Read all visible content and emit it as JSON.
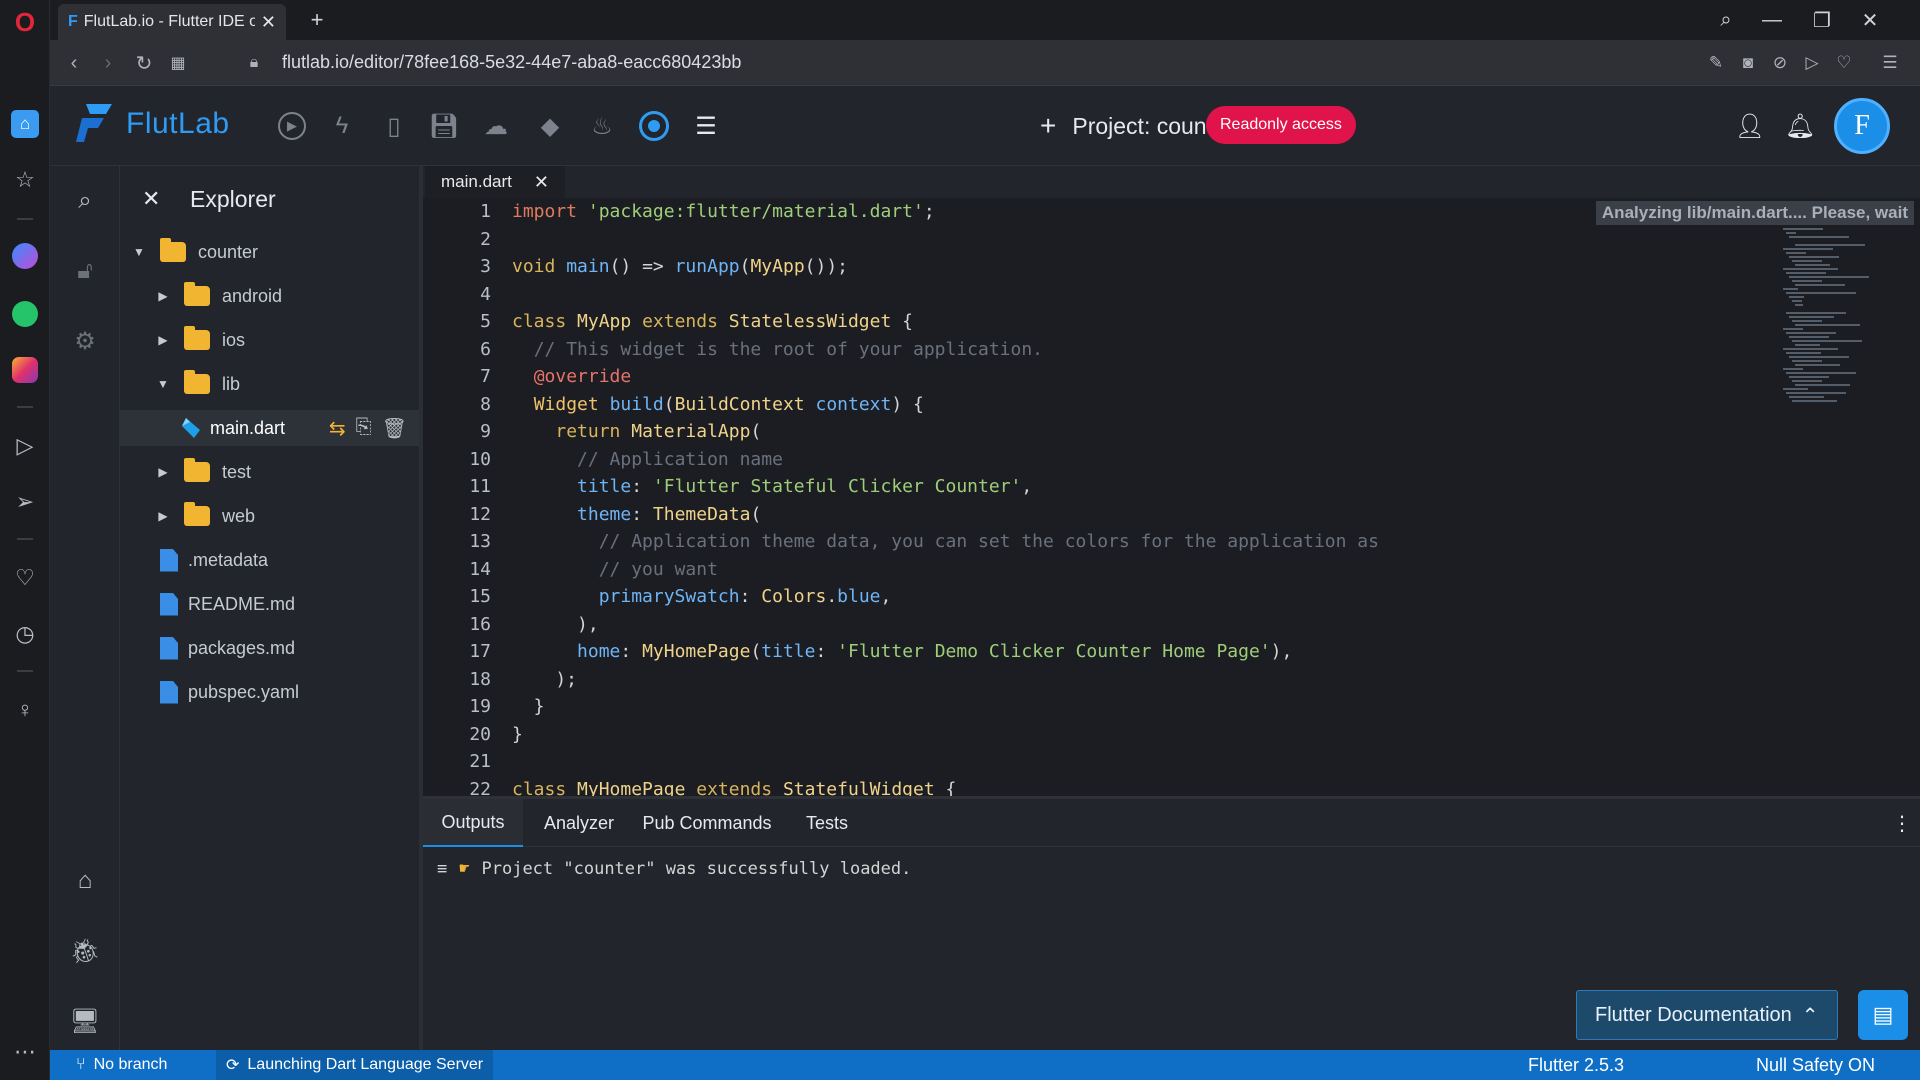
{
  "browser": {
    "tab_title": "FlutLab.io - Flutter IDE online",
    "url": "flutlab.io/editor/78fee168-5e32-44e7-aba8-eacc680423bb"
  },
  "header": {
    "logo_text": "FlutLab",
    "project_label": "Project: counter",
    "readonly_badge": "Readonly access",
    "avatar_letter": "F"
  },
  "explorer": {
    "title": "Explorer",
    "tree": [
      {
        "label": "counter",
        "kind": "folder",
        "expanded": true
      },
      {
        "label": "android",
        "kind": "folder"
      },
      {
        "label": "ios",
        "kind": "folder"
      },
      {
        "label": "lib",
        "kind": "folder",
        "expanded": true
      },
      {
        "label": "main.dart",
        "kind": "dart",
        "selected": true
      },
      {
        "label": "test",
        "kind": "folder"
      },
      {
        "label": "web",
        "kind": "folder"
      },
      {
        "label": ".metadata",
        "kind": "file"
      },
      {
        "label": "README.md",
        "kind": "file"
      },
      {
        "label": "packages.md",
        "kind": "file"
      },
      {
        "label": "pubspec.yaml",
        "kind": "file"
      }
    ]
  },
  "editor": {
    "tab_label": "main.dart",
    "analyzing_text": "Analyzing lib/main.dart.... Please, wait",
    "line_numbers": [
      "1",
      "2",
      "3",
      "4",
      "5",
      "6",
      "7",
      "8",
      "9",
      "10",
      "11",
      "12",
      "13",
      "14",
      "15",
      "16",
      "17",
      "18",
      "19",
      "20",
      "21",
      "22"
    ]
  },
  "panel": {
    "tabs": [
      "Outputs",
      "Analyzer",
      "Pub Commands",
      "Tests"
    ],
    "output_message": "Project \"counter\" was successfully loaded."
  },
  "docs_button": "Flutter Documentation",
  "statusbar": {
    "branch": "No branch",
    "server": "Launching Dart Language Server",
    "flutter_version": "Flutter 2.5.3",
    "null_safety": "Null Safety ON"
  },
  "colors": {
    "accent": "#1b8fe8",
    "badge": "#e0134a",
    "statusbar": "#0f6fc6"
  }
}
